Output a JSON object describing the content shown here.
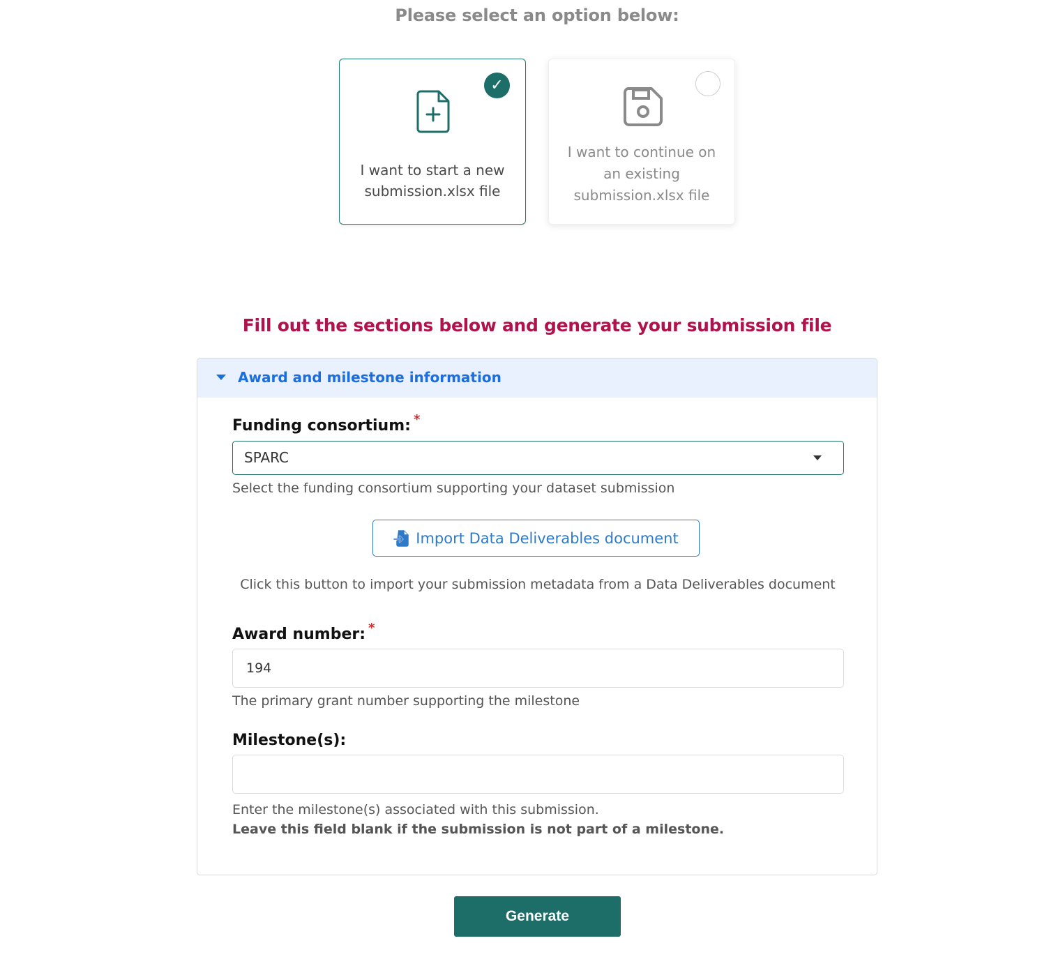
{
  "prompt": {
    "title": "Please select an option below:"
  },
  "options": [
    {
      "label": "I want to start a new submission.xlsx file",
      "icon": "file-plus-icon",
      "selected": true
    },
    {
      "label": "I want to continue on an existing submission.xlsx file",
      "icon": "floppy-disk-icon",
      "selected": false
    }
  ],
  "section": {
    "heading": "Fill out the sections below and generate your submission file"
  },
  "panel": {
    "title": "Award and milestone information",
    "expanded": true,
    "funding": {
      "label": "Funding consortium:",
      "required_mark": "*",
      "value": "SPARC",
      "help": "Select the funding consortium supporting your dataset submission"
    },
    "import": {
      "button_label": "Import Data Deliverables document",
      "help": "Click this button to import your submission metadata from a Data Deliverables document"
    },
    "award": {
      "label": "Award number:",
      "required_mark": "*",
      "value": "194",
      "help": "The primary grant number supporting the milestone"
    },
    "milestone": {
      "label": "Milestone(s):",
      "value": "",
      "help": "Enter the milestone(s) associated with this submission.",
      "note": "Leave this field blank if the submission is not part of a milestone."
    }
  },
  "actions": {
    "generate_label": "Generate"
  },
  "colors": {
    "teal": "#1d6e68",
    "heading_red": "#b0124c",
    "link_blue": "#1a6ee0",
    "header_bg": "#e8f1fd"
  }
}
